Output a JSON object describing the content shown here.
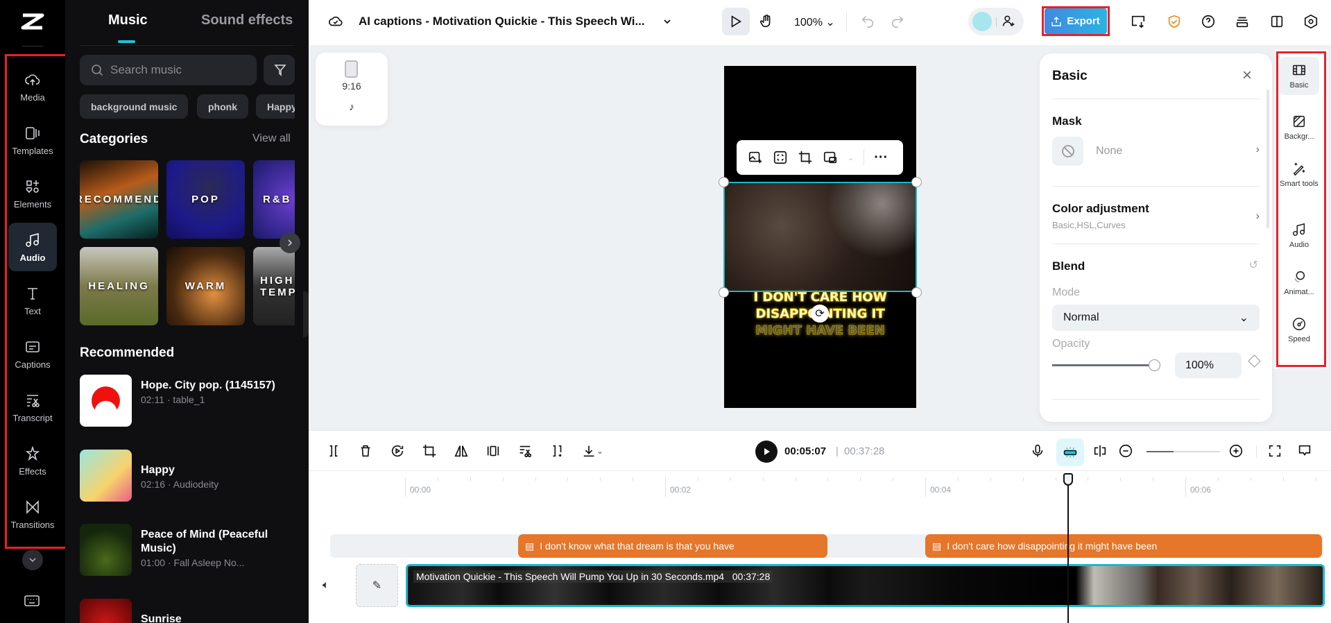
{
  "rail": {
    "items": [
      {
        "label": "Media",
        "icon": "cloud-upload-icon"
      },
      {
        "label": "Templates",
        "icon": "templates-icon"
      },
      {
        "label": "Elements",
        "icon": "elements-icon"
      },
      {
        "label": "Audio",
        "icon": "music-note-icon"
      },
      {
        "label": "Text",
        "icon": "text-icon"
      },
      {
        "label": "Captions",
        "icon": "captions-icon"
      },
      {
        "label": "Transcript",
        "icon": "transcript-icon"
      },
      {
        "label": "Effects",
        "icon": "effects-icon"
      },
      {
        "label": "Transitions",
        "icon": "transitions-icon"
      }
    ],
    "active": "Audio"
  },
  "music": {
    "tabs": [
      "Music",
      "Sound effects"
    ],
    "search_placeholder": "Search music",
    "chips": [
      "background music",
      "phonk",
      "Happy"
    ],
    "categories_title": "Categories",
    "view_all": "View all",
    "categories": [
      "RECOMMEND",
      "POP",
      "R&B",
      "HEALING",
      "WARM",
      "HIGH TEMPO"
    ],
    "recommended_title": "Recommended",
    "songs": [
      {
        "title": "Hope. City pop. (1145157)",
        "meta": "02:11 · table_1"
      },
      {
        "title": "Happy",
        "meta": "02:16 · Audiodeity"
      },
      {
        "title": "Peace of Mind (Peaceful Music)",
        "meta": "01:00 · Fall Asleep No..."
      },
      {
        "title": "Sunrise",
        "meta": ""
      }
    ]
  },
  "header": {
    "title": "AI captions - Motivation Quickie - This Speech Wi...",
    "zoom": "100%",
    "export": "Export",
    "accent": "#3b8de0"
  },
  "canvas": {
    "aspect": "9:16",
    "caption_lines": [
      "I DON'T CARE HOW",
      "DISAPPOINTING IT",
      "MIGHT HAVE BEEN"
    ]
  },
  "basic": {
    "title": "Basic",
    "mask_label": "Mask",
    "mask_value": "None",
    "color_label": "Color adjustment",
    "color_sub": "Basic,HSL,Curves",
    "blend_label": "Blend",
    "mode_label": "Mode",
    "mode_value": "Normal",
    "opacity_label": "Opacity",
    "opacity_value": "100%",
    "opacity_fraction": 1.0
  },
  "right_rail": [
    "Basic",
    "Backgr...",
    "Smart tools",
    "Audio",
    "Animat...",
    "Speed"
  ],
  "timeline": {
    "current": "00:05:07",
    "total": "00:37:28",
    "ticks": [
      "00:00",
      "00:02",
      "00:04",
      "00:06"
    ],
    "playhead_seconds": 5.1,
    "captions": [
      "I don't know what that dream is that you have",
      "I don't care how disappointing it might have been"
    ],
    "clip_name": "Motivation Quickie - This Speech Will Pump You Up in 30 Seconds.mp4",
    "clip_duration": "00:37:28",
    "zoom_fraction": 0.37
  }
}
